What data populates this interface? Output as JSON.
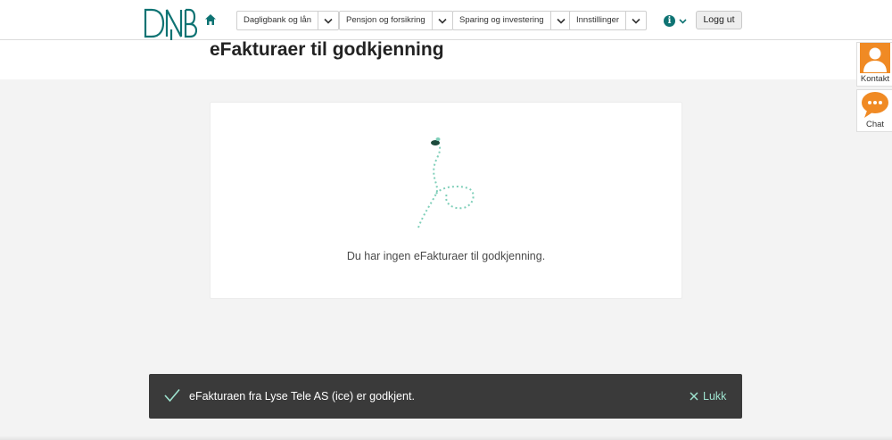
{
  "header": {
    "logo_text": "DNB",
    "nav": [
      {
        "label": "Dagligbank og lån"
      },
      {
        "label": "Pensjon og forsikring"
      },
      {
        "label": "Sparing og investering"
      },
      {
        "label": "Innstillinger"
      }
    ],
    "info_glyph": "i",
    "logout_label": "Logg ut"
  },
  "page": {
    "title": "eFakturaer til godkjenning",
    "empty_message": "Du har ingen eFakturaer til godkjenning."
  },
  "side": {
    "contact_label": "Kontakt",
    "chat_label": "Chat"
  },
  "toast": {
    "message": "eFakturaen fra Lyse Tele AS (ice) er godkjent.",
    "close_label": "Lukk"
  },
  "colors": {
    "brand": "#0e7373",
    "accent_orange": "#f08a24",
    "toast_bg": "#3a3a3a",
    "toast_link": "#9ee3cf"
  }
}
